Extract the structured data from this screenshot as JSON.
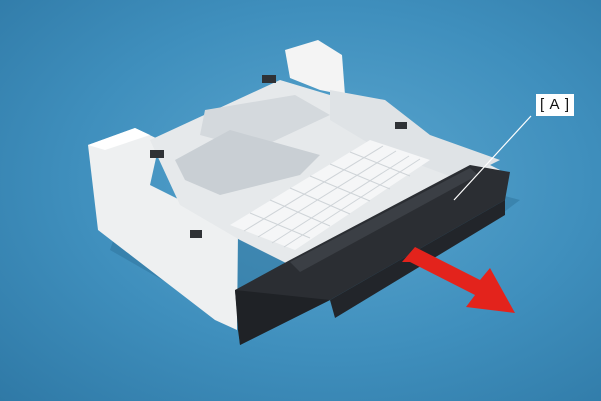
{
  "figure": {
    "callout": {
      "label": "[ A ]"
    },
    "colors": {
      "background": "#4a98c6",
      "unit_body": "#f2f2f2",
      "unit_shadow": "#c9cfd4",
      "tray_front": "#2a2d31",
      "arrow": "#e3231c",
      "leader_line": "#ffffff"
    },
    "icons": {
      "direction_arrow": "arrow-right-down-icon"
    }
  }
}
